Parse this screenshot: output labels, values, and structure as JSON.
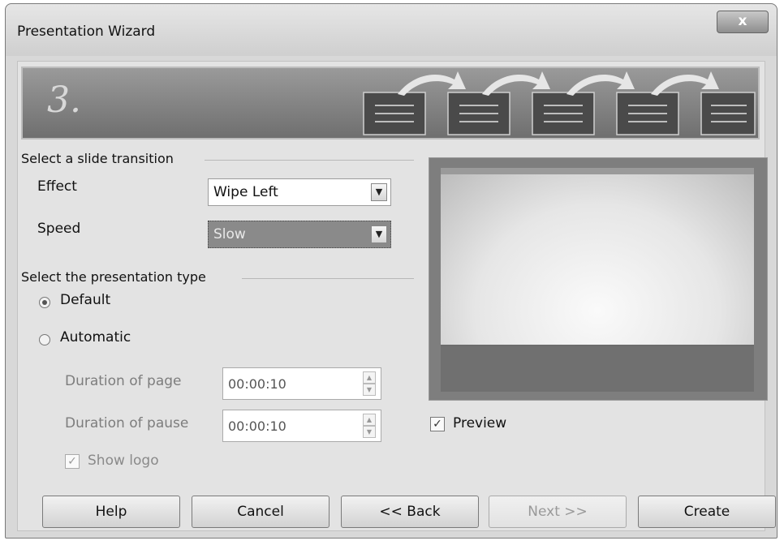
{
  "window": {
    "title": "Presentation Wizard",
    "close_glyph": "x"
  },
  "banner": {
    "step": "3."
  },
  "transition": {
    "group_label": "Select a slide transition",
    "effect_label": "Effect",
    "effect_value": "Wipe Left",
    "speed_label": "Speed",
    "speed_value": "Slow"
  },
  "type": {
    "group_label": "Select the presentation type",
    "default_label": "Default",
    "automatic_label": "Automatic",
    "selected": "Default",
    "duration_page_label": "Duration of page",
    "duration_page_value": "00:00:10",
    "duration_pause_label": "Duration of pause",
    "duration_pause_value": "00:00:10",
    "show_logo_label": "Show logo",
    "show_logo_checked": true
  },
  "preview": {
    "label": "Preview",
    "checked": true
  },
  "buttons": {
    "help": "Help",
    "cancel": "Cancel",
    "back": "<< Back",
    "next": "Next >>",
    "create": "Create"
  },
  "colors": {
    "banner": "#7a7a7a",
    "dialog": "#e3e3e3"
  }
}
